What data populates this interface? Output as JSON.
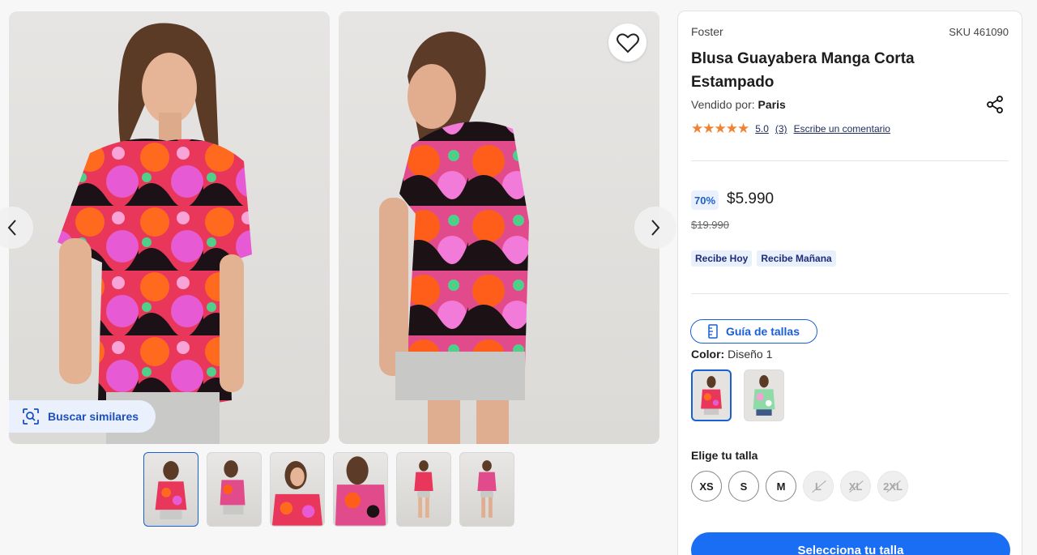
{
  "gallery": {
    "similar_label": "Buscar similares",
    "thumbnail_count": 6
  },
  "product": {
    "brand": "Foster",
    "sku": "SKU 461090",
    "title": "Blusa Guayabera Manga Corta Estampado",
    "seller_prefix": "Vendido por:",
    "seller_name": "Paris",
    "rating_value": "5.0",
    "rating_count": "(3)",
    "review_link": "Escribe un comentario",
    "stars": "★★★★★"
  },
  "pricing": {
    "discount": "70%",
    "price": "$5.990",
    "original_price": "$19.990"
  },
  "delivery": {
    "badges": [
      "Recibe Hoy",
      "Recibe Mañana"
    ]
  },
  "options": {
    "size_guide_label": "Guía de tallas",
    "color_label": "Color:",
    "color_value": "Diseño 1",
    "size_title": "Elige tu talla",
    "sizes": [
      {
        "label": "XS",
        "available": true
      },
      {
        "label": "S",
        "available": true
      },
      {
        "label": "M",
        "available": true
      },
      {
        "label": "L",
        "available": false
      },
      {
        "label": "XL",
        "available": false
      },
      {
        "label": "2XL",
        "available": false
      }
    ],
    "cta_label": "Selecciona tu talla"
  },
  "colors": {
    "accent": "#1a6ef4",
    "star": "#f08232",
    "badge_bg": "#e8f0fc"
  }
}
